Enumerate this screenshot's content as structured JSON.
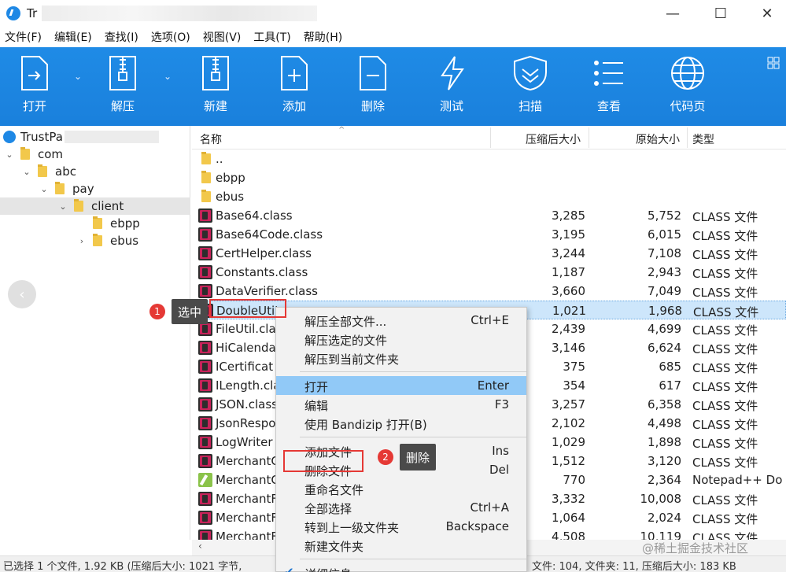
{
  "titlebar": {
    "title": "Tr",
    "minimize": "—",
    "maximize": "☐",
    "close": "✕"
  },
  "menu": [
    "文件(F)",
    "编辑(E)",
    "查找(I)",
    "选项(O)",
    "视图(V)",
    "工具(T)",
    "帮助(H)"
  ],
  "toolbar": {
    "open": "打开",
    "extract": "解压",
    "new": "新建",
    "add": "添加",
    "delete": "删除",
    "test": "测试",
    "scan": "扫描",
    "view": "查看",
    "codepage": "代码页"
  },
  "tree": {
    "root": "TrustPa",
    "items": [
      {
        "label": "com",
        "twisty": "⌄"
      },
      {
        "label": "abc",
        "twisty": "⌄"
      },
      {
        "label": "pay",
        "twisty": "⌄"
      },
      {
        "label": "client",
        "twisty": "⌄"
      },
      {
        "label": "ebpp",
        "twisty": ""
      },
      {
        "label": "ebus",
        "twisty": "›"
      }
    ],
    "back": "‹"
  },
  "columns": {
    "name": "名称",
    "compressed": "压缩后大小",
    "original": "原始大小",
    "type": "类型",
    "sort": "^"
  },
  "rows": [
    {
      "name": "..",
      "c": "",
      "o": "",
      "t": "",
      "kind": "folder"
    },
    {
      "name": "ebpp",
      "c": "",
      "o": "",
      "t": "",
      "kind": "folder"
    },
    {
      "name": "ebus",
      "c": "",
      "o": "",
      "t": "",
      "kind": "folder"
    },
    {
      "name": "Base64.class",
      "c": "3,285",
      "o": "5,752",
      "t": "CLASS 文件",
      "kind": "class"
    },
    {
      "name": "Base64Code.class",
      "c": "3,195",
      "o": "6,015",
      "t": "CLASS 文件",
      "kind": "class"
    },
    {
      "name": "CertHelper.class",
      "c": "3,244",
      "o": "7,108",
      "t": "CLASS 文件",
      "kind": "class"
    },
    {
      "name": "Constants.class",
      "c": "1,187",
      "o": "2,943",
      "t": "CLASS 文件",
      "kind": "class"
    },
    {
      "name": "DataVerifier.class",
      "c": "3,660",
      "o": "7,049",
      "t": "CLASS 文件",
      "kind": "class"
    },
    {
      "name": "DoubleUti'",
      "c": "1,021",
      "o": "1,968",
      "t": "CLASS 文件",
      "kind": "class"
    },
    {
      "name": "FileUtil.cla",
      "c": "2,439",
      "o": "4,699",
      "t": "CLASS 文件",
      "kind": "class"
    },
    {
      "name": "HiCalenda",
      "c": "3,146",
      "o": "6,624",
      "t": "CLASS 文件",
      "kind": "class"
    },
    {
      "name": "ICertificat",
      "c": "375",
      "o": "685",
      "t": "CLASS 文件",
      "kind": "class"
    },
    {
      "name": "ILength.cla",
      "c": "354",
      "o": "617",
      "t": "CLASS 文件",
      "kind": "class"
    },
    {
      "name": "JSON.class",
      "c": "3,257",
      "o": "6,358",
      "t": "CLASS 文件",
      "kind": "class"
    },
    {
      "name": "JsonRespo",
      "c": "2,102",
      "o": "4,498",
      "t": "CLASS 文件",
      "kind": "class"
    },
    {
      "name": "LogWriter",
      "c": "1,029",
      "o": "1,898",
      "t": "CLASS 文件",
      "kind": "class"
    },
    {
      "name": "MerchantC",
      "c": "1,512",
      "o": "3,120",
      "t": "CLASS 文件",
      "kind": "class"
    },
    {
      "name": "MerchantC",
      "c": "770",
      "o": "2,364",
      "t": "Notepad++ Do",
      "kind": "notepad"
    },
    {
      "name": "MerchantF",
      "c": "3,332",
      "o": "10,008",
      "t": "CLASS 文件",
      "kind": "class"
    },
    {
      "name": "MerchantF",
      "c": "1,064",
      "o": "2,024",
      "t": "CLASS 文件",
      "kind": "class"
    },
    {
      "name": "MerchantF",
      "c": "4,508",
      "o": "10,119",
      "t": "CLASS 文件",
      "kind": "class"
    }
  ],
  "context_menu": {
    "items": [
      {
        "label": "解压全部文件...",
        "key": "Ctrl+E"
      },
      {
        "label": "解压选定的文件",
        "key": ""
      },
      {
        "label": "解压到当前文件夹",
        "key": ""
      },
      {
        "sep": true
      },
      {
        "label": "打开",
        "key": "Enter",
        "highlight": true
      },
      {
        "label": "编辑",
        "key": "F3"
      },
      {
        "label": "使用 Bandizip 打开(B)",
        "key": ""
      },
      {
        "sep": true
      },
      {
        "label": "添加文件",
        "key": "Ins"
      },
      {
        "label": "删除文件",
        "key": "Del"
      },
      {
        "label": "重命名文件",
        "key": ""
      },
      {
        "label": "全部选择",
        "key": "Ctrl+A"
      },
      {
        "label": "转到上一级文件夹",
        "key": "Backspace"
      },
      {
        "label": "新建文件夹",
        "key": ""
      },
      {
        "sep": true
      },
      {
        "label": "详细信息",
        "key": "",
        "check": "✔"
      }
    ]
  },
  "annotations": {
    "badge1": "1",
    "tip1": "选中",
    "badge2": "2",
    "tip2": "删除"
  },
  "status": {
    "left": "已选择 1 个文件, 1.92 KB (压缩后大小: 1021 字节,",
    "right": "文件: 104, 文件夹: 11, 压缩后大小: 183 KB"
  },
  "watermark": "@稀土掘金技术社区",
  "colors": {
    "toolbar": "#1f8be6",
    "selection": "#cde6fb",
    "menu_highlight": "#91c9f7",
    "annotation": "#e53935"
  }
}
